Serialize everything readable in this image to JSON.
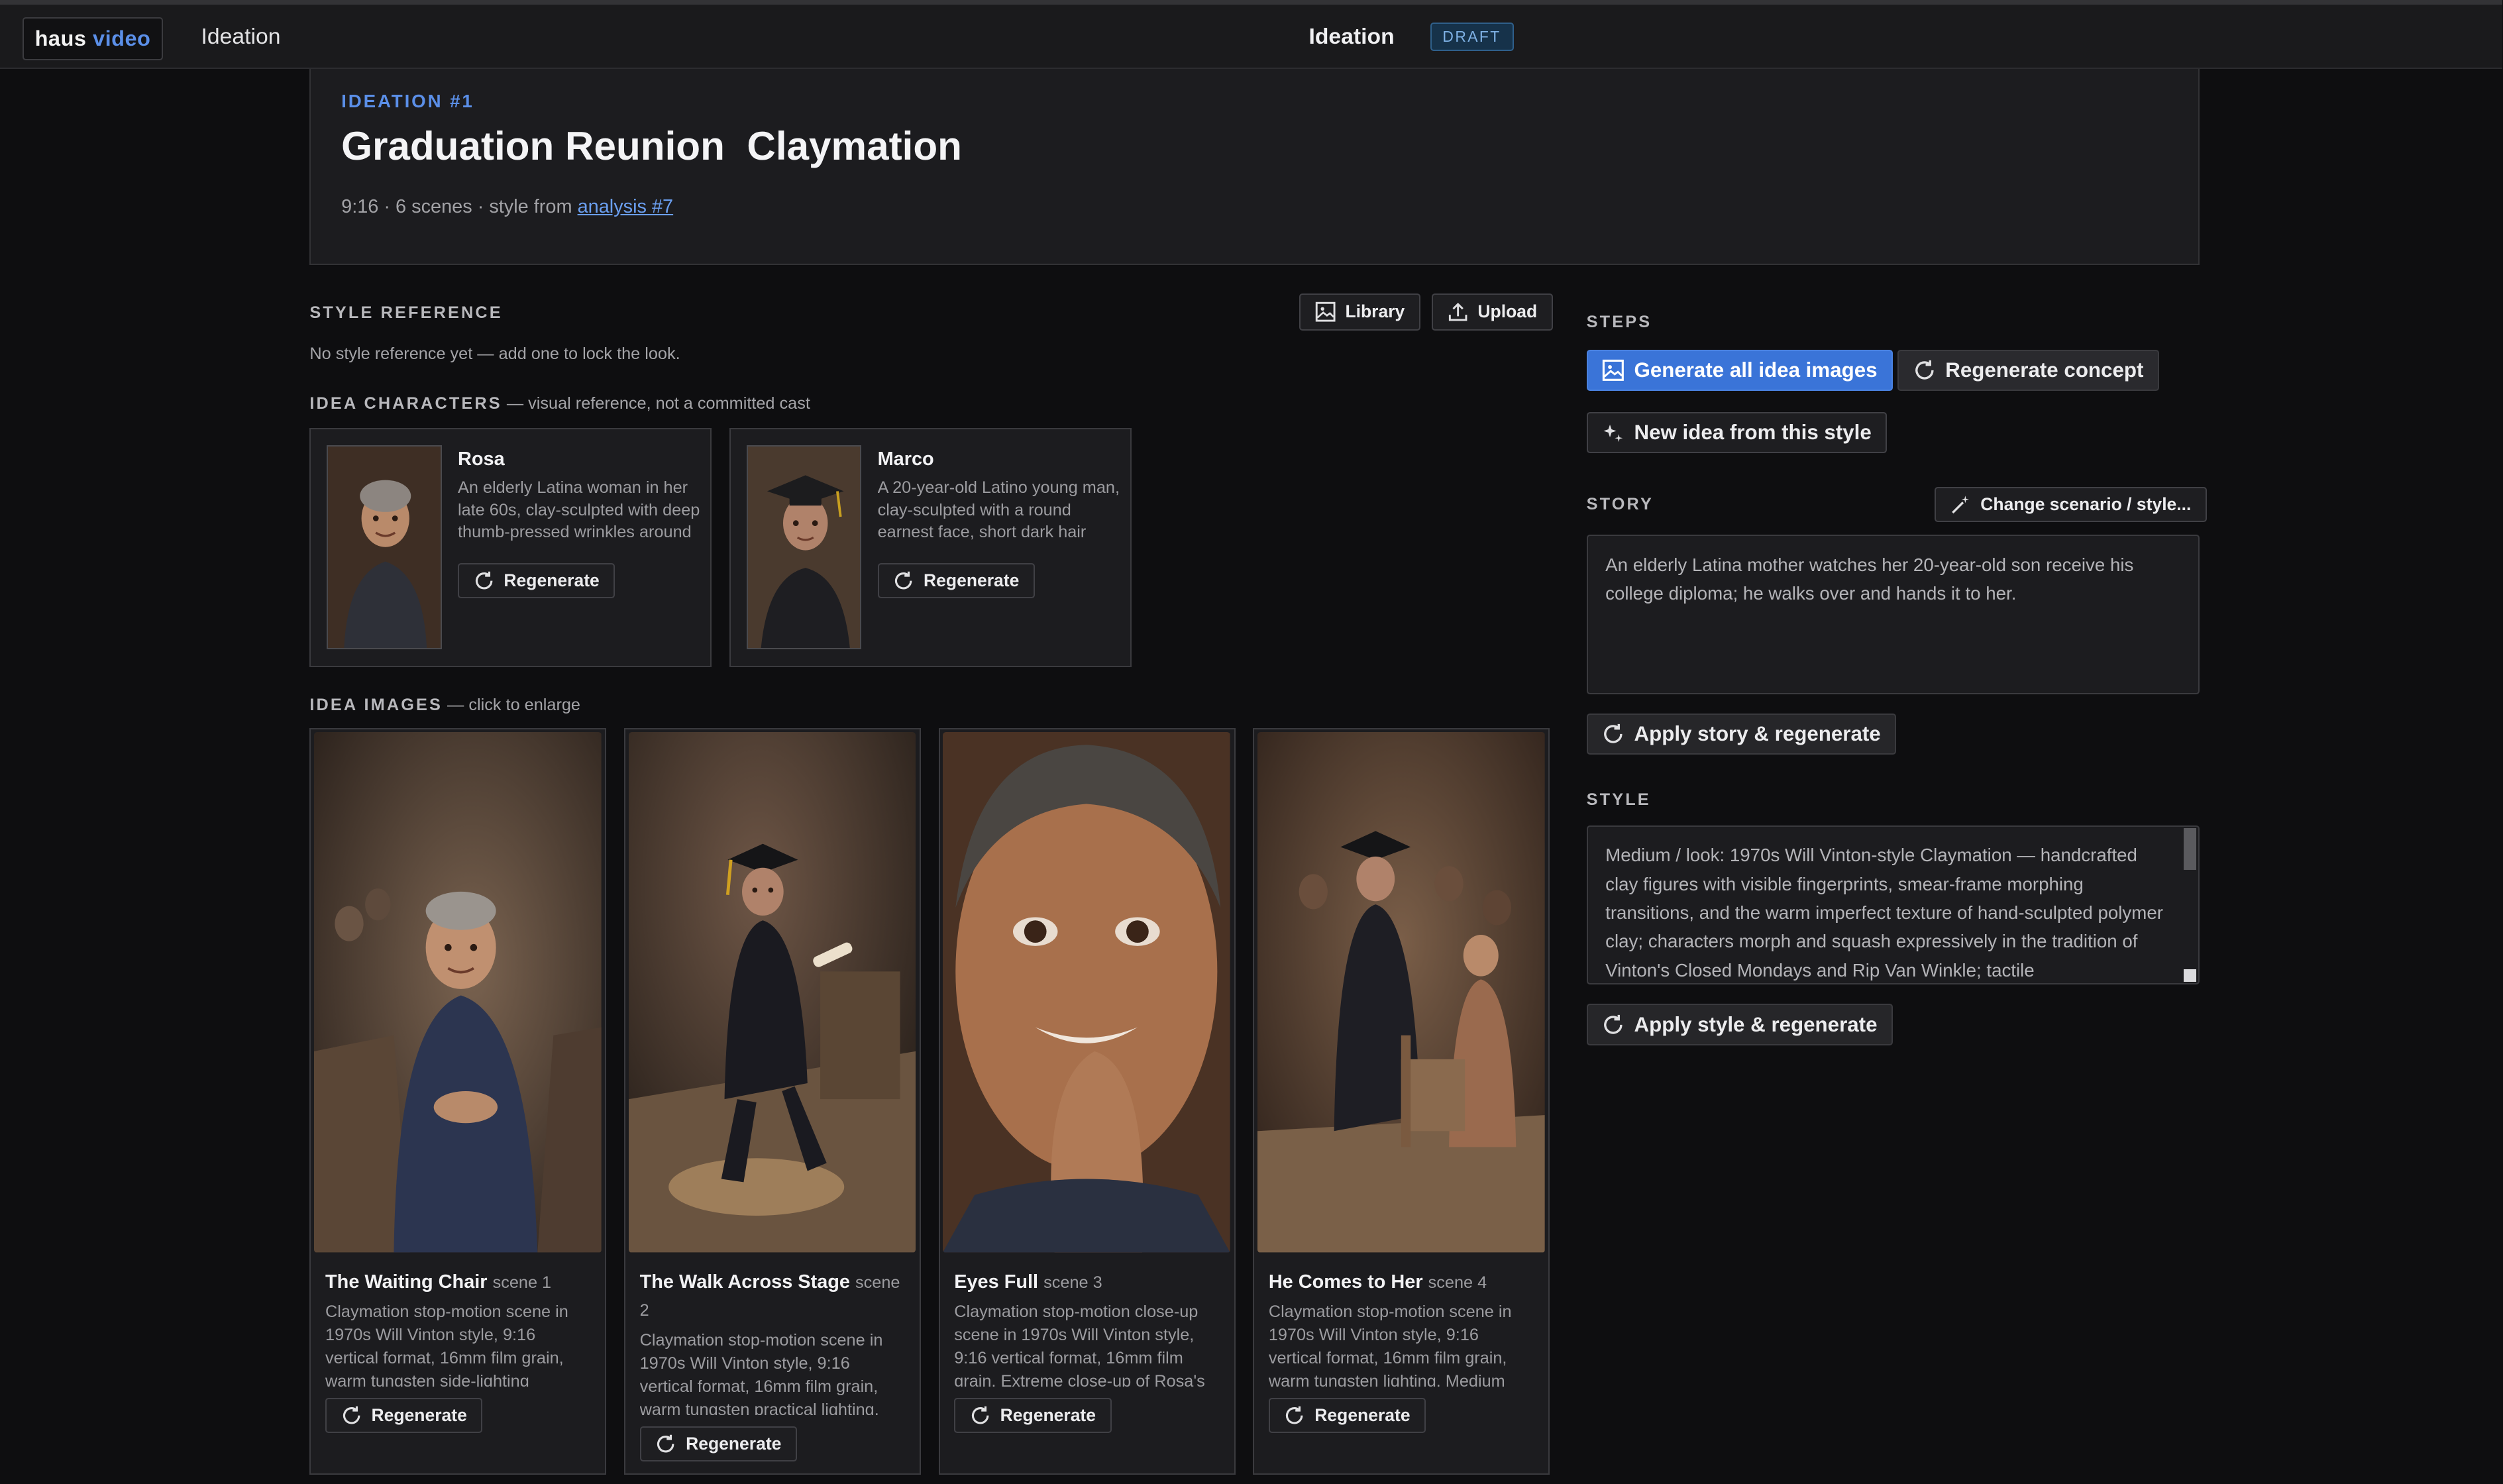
{
  "topbar": {
    "brand_main": "haus",
    "brand_accent": "video",
    "nav_label": "Ideation",
    "center_title": "Ideation",
    "badge": "DRAFT"
  },
  "hero": {
    "kicker": "IDEATION #1",
    "title": "Graduation Reunion  Claymation",
    "meta_prefix": "9:16 · 6 scenes · style from ",
    "meta_link": "analysis #7"
  },
  "style_reference": {
    "label": "STYLE REFERENCE",
    "library_button": "Library",
    "upload_button": "Upload",
    "empty_text": "No style reference yet — add one to lock the look."
  },
  "characters": {
    "label": "IDEA CHARACTERS",
    "sublabel": " — visual reference, not a committed cast",
    "items": [
      {
        "name": "Rosa",
        "description": "An elderly Latina woman in her late 60s, clay-sculpted with deep thumb-pressed wrinkles around her eyes and a gentle smile",
        "button": "Regenerate"
      },
      {
        "name": "Marco",
        "description": "A 20-year-old Latino young man, clay-sculpted with a round earnest face, short dark hair visible beneath a black cap",
        "button": "Regenerate"
      }
    ]
  },
  "images": {
    "label": "IDEA IMAGES",
    "sublabel": " — click to enlarge",
    "items": [
      {
        "title": "The Waiting Chair",
        "scene": "scene 1",
        "description": "Claymation stop-motion scene in 1970s Will Vinton style, 9:16 vertical format, 16mm film grain, warm tungsten side-lighting",
        "button": "Regenerate"
      },
      {
        "title": "The Walk Across Stage",
        "scene": "scene 2",
        "description": "Claymation stop-motion scene in 1970s Will Vinton style, 9:16 vertical format, 16mm film grain, warm tungsten practical lighting.",
        "button": "Regenerate"
      },
      {
        "title": "Eyes Full",
        "scene": "scene 3",
        "description": "Claymation stop-motion close-up scene in 1970s Will Vinton style, 9:16 vertical format, 16mm film grain. Extreme close-up of Rosa's",
        "button": "Regenerate"
      },
      {
        "title": "He Comes to Her",
        "scene": "scene 4",
        "description": "Claymation stop-motion scene in 1970s Will Vinton style, 9:16 vertical format, 16mm film grain, warm tungsten lighting. Medium",
        "button": "Regenerate"
      }
    ]
  },
  "steps": {
    "label": "STEPS",
    "generate_all": "Generate all idea images",
    "regenerate_concept": "Regenerate concept",
    "new_idea": "New idea from this style"
  },
  "story": {
    "label": "STORY",
    "change_button": "Change scenario / style...",
    "text": "An elderly Latina mother watches her 20-year-old son receive his college diploma; he walks over and hands it to her.",
    "apply_button": "Apply story & regenerate"
  },
  "style": {
    "label": "STYLE",
    "text": "Medium / look: 1970s Will Vinton-style Claymation — handcrafted clay figures with visible fingerprints, smear-frame morphing transitions, and the warm imperfect texture of hand-sculpted polymer clay; characters morph and squash expressively in the tradition of Vinton's Closed Mondays and Rip Van Winkle; tactile",
    "apply_button": "Apply style & regenerate"
  },
  "colors": {
    "accent": "#5b8fe8",
    "primary_button": "#3a74d8",
    "background": "#0e0e10",
    "panel": "#1c1c1f"
  }
}
